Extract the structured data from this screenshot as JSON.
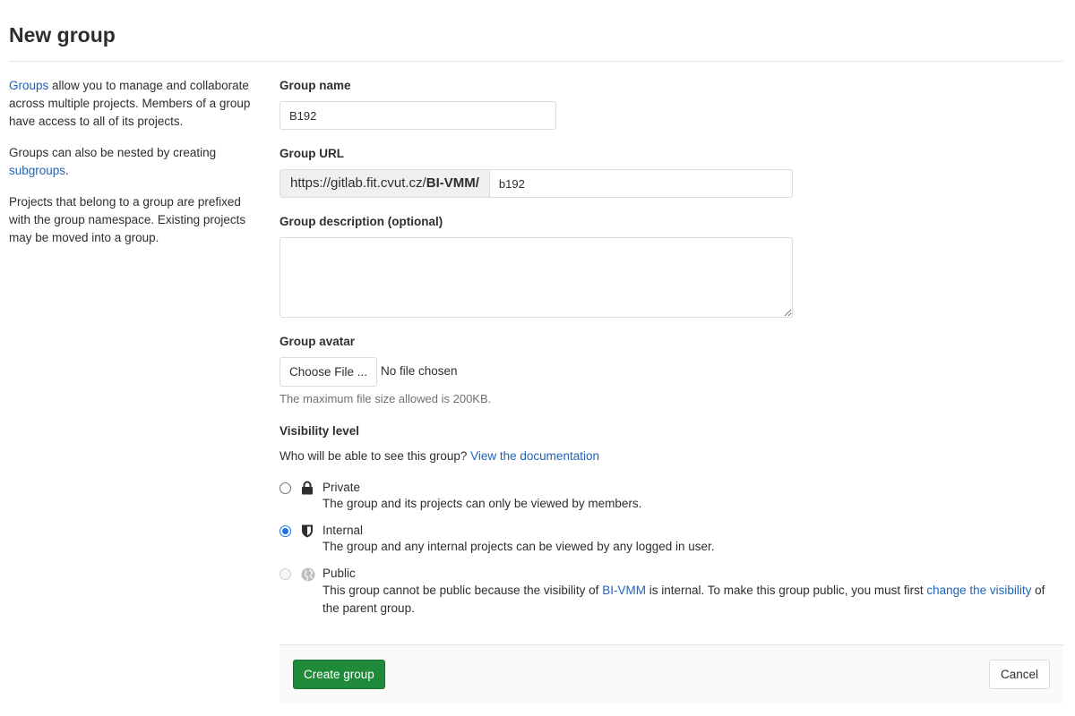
{
  "page": {
    "title": "New group"
  },
  "intro": {
    "p1_link": "Groups",
    "p1_text": " allow you to manage and collaborate across multiple projects. Members of a group have access to all of its projects.",
    "p2_text": "Groups can also be nested by creating ",
    "p2_link": "subgroups",
    "p2_end": ".",
    "p3_text": "Projects that belong to a group are prefixed with the group namespace. Existing projects may be moved into a group."
  },
  "form": {
    "group_name_label": "Group name",
    "group_name_value": "B192",
    "group_url_label": "Group URL",
    "group_url_prefix": "https://gitlab.fit.cvut.cz/",
    "group_url_prefix_bold": "BI-VMM/",
    "group_url_value": "b192",
    "description_label": "Group description (optional)",
    "description_value": "",
    "avatar_label": "Group avatar",
    "choose_file_label": "Choose File ...",
    "file_status": "No file chosen",
    "file_help": "The maximum file size allowed is 200KB.",
    "visibility_label": "Visibility level",
    "visibility_question": "Who will be able to see this group? ",
    "visibility_doc_link": "View the documentation"
  },
  "visibility": {
    "private": {
      "title": "Private",
      "desc": "The group and its projects can only be viewed by members.",
      "icon": "lock-icon",
      "checked": false
    },
    "internal": {
      "title": "Internal",
      "desc": "The group and any internal projects can be viewed by any logged in user.",
      "icon": "shield-icon",
      "checked": true
    },
    "public": {
      "title": "Public",
      "icon": "globe-icon",
      "disabled": true,
      "desc_1": "This group cannot be public because the visibility of ",
      "desc_link1": "BI-VMM",
      "desc_2": " is internal. To make this group public, you must first ",
      "desc_link2": "change the visibility",
      "desc_3": " of the parent group."
    }
  },
  "footer": {
    "create_label": "Create group",
    "cancel_label": "Cancel"
  },
  "colors": {
    "link": "#1f63b8",
    "primary_green": "#1f8a3a",
    "radio_checked": "#1a73e8"
  }
}
